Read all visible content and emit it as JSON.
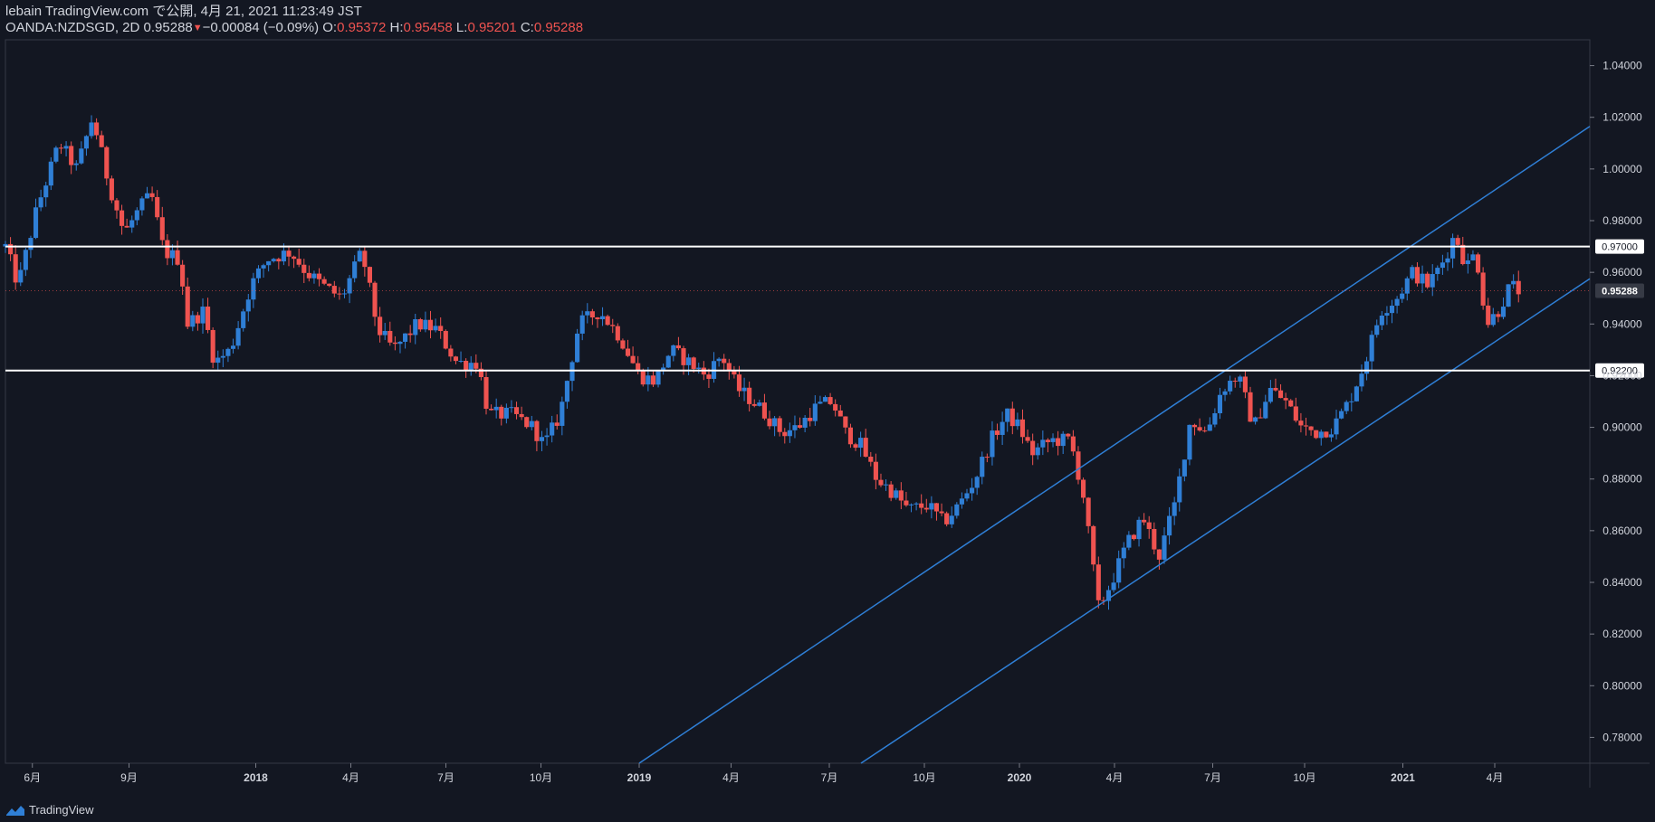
{
  "header": {
    "published_line": "lebain TradingView.com で公開, 4月 21, 2021 11:23:49 JST",
    "symbol": "OANDA:NZDSGD, 2D",
    "last": "0.95288",
    "change_arrow": "▼",
    "change": "−0.00084 (−0.09%)",
    "o_label": "O:",
    "o_value": "0.95372",
    "h_label": "H:",
    "h_value": "0.95458",
    "l_label": "L:",
    "l_value": "0.95201",
    "c_label": "C:",
    "c_value": "0.95288"
  },
  "footer": {
    "brand": "TradingView",
    "logo_icon": "tradingview-logo-icon"
  },
  "colors": {
    "background": "#131722",
    "up": "#2f7fd6",
    "down": "#ef5350",
    "channel": "#2f7fd6",
    "level": "#ffffff",
    "text": "#d1d4dc"
  },
  "chart_data": {
    "type": "candlestick",
    "symbol": "OANDA:NZDSGD",
    "interval": "2D",
    "ylim": [
      0.77,
      1.05
    ],
    "y_ticks": [
      "1.04000",
      "1.02000",
      "1.00000",
      "0.98000",
      "0.96000",
      "0.94000",
      "0.92000",
      "0.90000",
      "0.88000",
      "0.86000",
      "0.84000",
      "0.82000",
      "0.80000",
      "0.78000"
    ],
    "x_ticks": [
      {
        "label": "6月",
        "t": 0.017
      },
      {
        "label": "9月",
        "t": 0.078
      },
      {
        "label": "2018",
        "t": 0.158
      },
      {
        "label": "4月",
        "t": 0.218
      },
      {
        "label": "7月",
        "t": 0.278
      },
      {
        "label": "10月",
        "t": 0.338
      },
      {
        "label": "2019",
        "t": 0.4
      },
      {
        "label": "4月",
        "t": 0.458
      },
      {
        "label": "7月",
        "t": 0.52
      },
      {
        "label": "10月",
        "t": 0.58
      },
      {
        "label": "2020",
        "t": 0.64
      },
      {
        "label": "4月",
        "t": 0.7
      },
      {
        "label": "7月",
        "t": 0.762
      },
      {
        "label": "10月",
        "t": 0.82
      },
      {
        "label": "2021",
        "t": 0.882
      },
      {
        "label": "4月",
        "t": 0.94
      }
    ],
    "horizontal_levels": [
      {
        "value": 0.97,
        "label": "0.97000"
      },
      {
        "value": 0.922,
        "label": "0.92200"
      }
    ],
    "last_price_label": "0.95288",
    "last_price": 0.95288,
    "channel_lines": [
      {
        "t1": 0.4,
        "v1": 0.77,
        "t2": 1.0,
        "v2": 1.0165
      },
      {
        "t1": 0.54,
        "v1": 0.77,
        "t2": 1.0,
        "v2": 0.9575
      }
    ],
    "anchors": [
      [
        0.0,
        0.97
      ],
      [
        0.008,
        0.955
      ],
      [
        0.02,
        0.985
      ],
      [
        0.034,
        1.01
      ],
      [
        0.045,
        1.0
      ],
      [
        0.055,
        1.02
      ],
      [
        0.065,
        0.995
      ],
      [
        0.075,
        0.975
      ],
      [
        0.085,
        0.985
      ],
      [
        0.092,
        0.99
      ],
      [
        0.1,
        0.968
      ],
      [
        0.11,
        0.965
      ],
      [
        0.115,
        0.94
      ],
      [
        0.125,
        0.945
      ],
      [
        0.132,
        0.925
      ],
      [
        0.142,
        0.93
      ],
      [
        0.155,
        0.955
      ],
      [
        0.165,
        0.965
      ],
      [
        0.18,
        0.968
      ],
      [
        0.19,
        0.96
      ],
      [
        0.2,
        0.955
      ],
      [
        0.212,
        0.95
      ],
      [
        0.225,
        0.968
      ],
      [
        0.235,
        0.938
      ],
      [
        0.245,
        0.93
      ],
      [
        0.26,
        0.94
      ],
      [
        0.272,
        0.938
      ],
      [
        0.285,
        0.925
      ],
      [
        0.298,
        0.925
      ],
      [
        0.305,
        0.905
      ],
      [
        0.32,
        0.905
      ],
      [
        0.333,
        0.9
      ],
      [
        0.34,
        0.893
      ],
      [
        0.35,
        0.905
      ],
      [
        0.362,
        0.94
      ],
      [
        0.375,
        0.945
      ],
      [
        0.388,
        0.935
      ],
      [
        0.4,
        0.92
      ],
      [
        0.41,
        0.918
      ],
      [
        0.42,
        0.93
      ],
      [
        0.432,
        0.925
      ],
      [
        0.442,
        0.92
      ],
      [
        0.452,
        0.928
      ],
      [
        0.462,
        0.915
      ],
      [
        0.472,
        0.91
      ],
      [
        0.48,
        0.905
      ],
      [
        0.49,
        0.898
      ],
      [
        0.5,
        0.9
      ],
      [
        0.512,
        0.908
      ],
      [
        0.522,
        0.91
      ],
      [
        0.53,
        0.898
      ],
      [
        0.54,
        0.893
      ],
      [
        0.55,
        0.88
      ],
      [
        0.56,
        0.875
      ],
      [
        0.57,
        0.868
      ],
      [
        0.582,
        0.87
      ],
      [
        0.592,
        0.863
      ],
      [
        0.602,
        0.87
      ],
      [
        0.612,
        0.88
      ],
      [
        0.622,
        0.895
      ],
      [
        0.632,
        0.905
      ],
      [
        0.64,
        0.9
      ],
      [
        0.648,
        0.89
      ],
      [
        0.66,
        0.895
      ],
      [
        0.672,
        0.895
      ],
      [
        0.68,
        0.875
      ],
      [
        0.69,
        0.83
      ],
      [
        0.698,
        0.84
      ],
      [
        0.708,
        0.855
      ],
      [
        0.718,
        0.865
      ],
      [
        0.728,
        0.85
      ],
      [
        0.738,
        0.87
      ],
      [
        0.748,
        0.903
      ],
      [
        0.758,
        0.898
      ],
      [
        0.768,
        0.915
      ],
      [
        0.778,
        0.92
      ],
      [
        0.788,
        0.9
      ],
      [
        0.798,
        0.915
      ],
      [
        0.808,
        0.91
      ],
      [
        0.818,
        0.9
      ],
      [
        0.828,
        0.898
      ],
      [
        0.838,
        0.9
      ],
      [
        0.848,
        0.91
      ],
      [
        0.858,
        0.925
      ],
      [
        0.868,
        0.945
      ],
      [
        0.878,
        0.95
      ],
      [
        0.888,
        0.96
      ],
      [
        0.898,
        0.955
      ],
      [
        0.908,
        0.965
      ],
      [
        0.915,
        0.975
      ],
      [
        0.922,
        0.962
      ],
      [
        0.928,
        0.968
      ],
      [
        0.935,
        0.94
      ],
      [
        0.942,
        0.945
      ],
      [
        0.95,
        0.955
      ],
      [
        0.955,
        0.953
      ]
    ]
  }
}
